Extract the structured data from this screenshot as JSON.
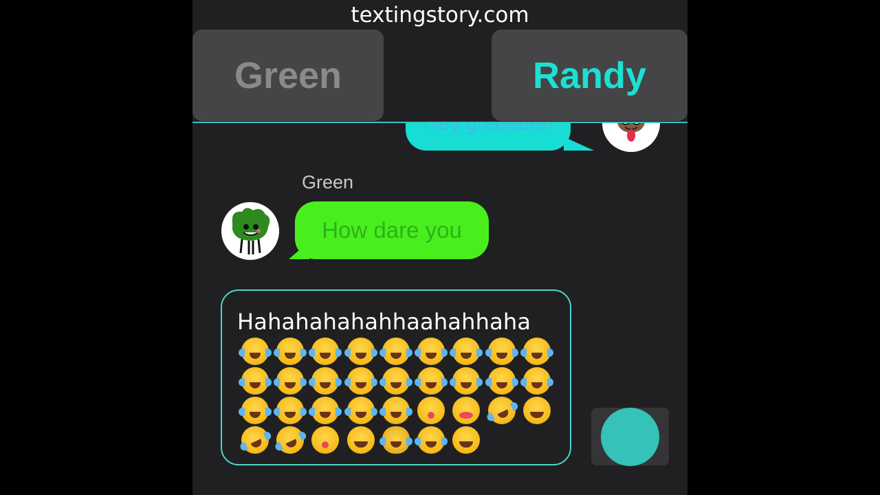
{
  "site": {
    "label": "textingstory.com"
  },
  "header": {
    "contacts": [
      {
        "label": "Green",
        "state": "inactive",
        "color": "#8a8a8c"
      },
      {
        "label": "Randy",
        "state": "active",
        "color": "#1de0d3"
      }
    ],
    "divider_color": "#2ec9c1"
  },
  "chat": {
    "messages": [
      {
        "sender": "Randy",
        "text": "Hey greeeeen",
        "bubble_color": "#18ddd4",
        "avatar_icon": "randy-avatar-icon"
      },
      {
        "sender": "Green",
        "text": "How dare you",
        "bubble_color": "#49ef1c",
        "avatar_icon": "green-avatar-icon"
      }
    ]
  },
  "composer": {
    "text": "Hahahahahahhaahahhaha",
    "emoji": [
      "joy",
      "joy",
      "joy",
      "joy",
      "joy",
      "joy",
      "joy",
      "joy",
      "joy",
      "joy",
      "joy",
      "joy",
      "joy",
      "joy",
      "joy",
      "joy",
      "joy",
      "joy",
      "joy",
      "joy",
      "joy",
      "joy",
      "joy",
      "zany",
      "squint-tongue",
      "rofl",
      "laughing",
      "rofl",
      "rofl",
      "zany",
      "laughing",
      "joy-cat",
      "joy",
      "laughing"
    ],
    "border_color": "#4ed6cf"
  },
  "send": {
    "icon": "send-circle-icon",
    "color": "#35c2b9"
  }
}
